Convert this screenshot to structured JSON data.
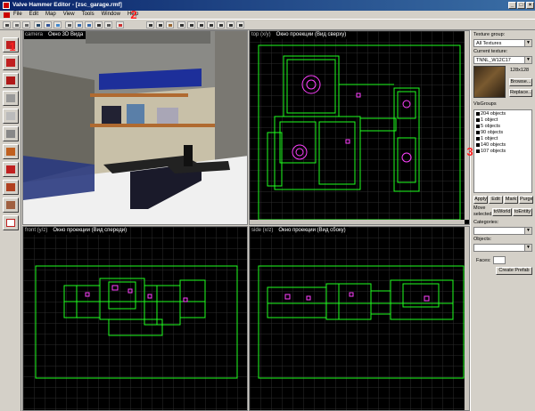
{
  "window": {
    "title": "Valve Hammer Editor - [zsc_garage.rmf]",
    "controls": [
      "_",
      "□",
      "×"
    ]
  },
  "menu": [
    "File",
    "Edit",
    "Map",
    "View",
    "Tools",
    "Window",
    "Help"
  ],
  "viewports": {
    "camera": {
      "key": "camera",
      "title": "Окно 3D Вида"
    },
    "top": {
      "key": "top (x/y)",
      "title": "Окно проекции (Вид сверху)"
    },
    "front": {
      "key": "front (y/z)",
      "title": "Окно проекции (Вид спереди)"
    },
    "side": {
      "key": "side (x/z)",
      "title": "Окно проекции (Вид сбоку)"
    }
  },
  "texture": {
    "group_label": "Texture group:",
    "group_value": "All Textures",
    "current_label": "Current texture:",
    "current_value": "TNNL_W12C17",
    "size": "128x128",
    "browse": "Browse...",
    "replace": "Replace..."
  },
  "visgroups": {
    "label": "VisGroups",
    "items": [
      "204 objects",
      "1 object",
      "5 objects",
      "90 objects",
      "1 object",
      "140 objects",
      "107 objects"
    ],
    "buttons": [
      "Apply",
      "Edit",
      "Mark",
      "Purge"
    ]
  },
  "move": {
    "label_1": "Move",
    "label_2": "selected:",
    "to_world": "toWorld",
    "to_entity": "toEntity"
  },
  "categories_label": "Categories:",
  "objects_label": "Objects:",
  "faces_label": "Faces:",
  "create_prefab": "Create Prefab",
  "markers": [
    "1",
    "2",
    "3"
  ],
  "colors": {
    "grid": "#2c2c2c",
    "brush": "#20ff20",
    "entity": "#ff40ff",
    "title_bar": "#0a246a"
  }
}
